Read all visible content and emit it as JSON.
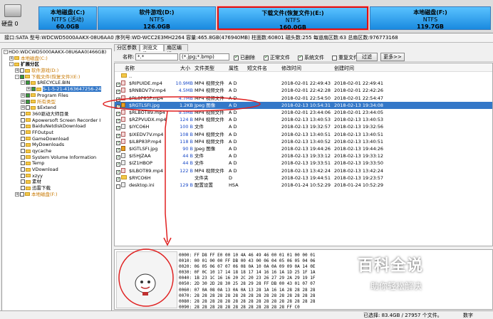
{
  "disk": {
    "label": "硬盘 0"
  },
  "partitions": [
    {
      "name": "本地磁盘(C:)",
      "fs": "NTFS (活动)",
      "size": "60.0GB"
    },
    {
      "name": "软件游戏(D:)",
      "fs": "NTFS",
      "size": "126.0GB"
    },
    {
      "name": "下载文件(恢复文件)(E:)",
      "fs": "NTFS",
      "size": "160.0GB"
    },
    {
      "name": "本地磁盘(F:)",
      "fs": "NTFS",
      "size": "119.7GB"
    }
  ],
  "diskinfo": "接口:SATA  型号:WDCWD5000AAKX-08U6AA0  序列号:WD-WCC2E3MH2264  容量:465.8GB(476940MB)  柱面数:60801  磁头数:255  每道扇区数:63  总扇区数:976773168",
  "tree": [
    {
      "label": "HD0:WDCWD5000AAKX-08U6AA0(466GB)",
      "level": 0,
      "exp": "-",
      "cb": false,
      "folder": false,
      "style": ""
    },
    {
      "label": "本地磁盘(C:)",
      "level": 1,
      "exp": "+",
      "cb": false,
      "folder": true,
      "style": "orange"
    },
    {
      "label": "扩展分区",
      "level": 1,
      "exp": "-",
      "cb": false,
      "folder": true,
      "style": "bold"
    },
    {
      "label": "软件游戏(D:)",
      "level": 2,
      "exp": "+",
      "cb": false,
      "folder": true,
      "style": "orange"
    },
    {
      "label": "下载文件(恢复文件)(E:)",
      "level": 2,
      "exp": "-",
      "cb": true,
      "folder": true,
      "style": "orange"
    },
    {
      "label": "$RECYCLE.BIN",
      "level": 3,
      "exp": "-",
      "cb": true,
      "folder": true,
      "style": ""
    },
    {
      "label": "S-1-5-21-4163647256-24",
      "level": 4,
      "exp": "+",
      "cb": true,
      "folder": true,
      "style": "sel"
    },
    {
      "label": "Program Files",
      "level": 3,
      "exp": "+",
      "cb": true,
      "folder": true,
      "style": ""
    },
    {
      "label": "所有类型",
      "level": 3,
      "exp": "+",
      "cb": true,
      "folder": true,
      "style": "orange"
    },
    {
      "label": "$Extend",
      "level": 3,
      "exp": "+",
      "cb": false,
      "folder": true,
      "style": ""
    },
    {
      "label": "360驱动大师目录",
      "level": 3,
      "exp": "",
      "cb": false,
      "folder": true,
      "style": ""
    },
    {
      "label": "Apowersoft Screen Recorder I",
      "level": 3,
      "exp": "",
      "cb": false,
      "folder": true,
      "style": ""
    },
    {
      "label": "BaiduNetdiskDownload",
      "level": 3,
      "exp": "",
      "cb": false,
      "folder": true,
      "style": ""
    },
    {
      "label": "FFOutput",
      "level": 3,
      "exp": "",
      "cb": false,
      "folder": true,
      "style": ""
    },
    {
      "label": "GameDownload",
      "level": 3,
      "exp": "",
      "cb": false,
      "folder": true,
      "style": ""
    },
    {
      "label": "MyDownloads",
      "level": 3,
      "exp": "",
      "cb": false,
      "folder": true,
      "style": ""
    },
    {
      "label": "qycache",
      "level": 3,
      "exp": "",
      "cb": false,
      "folder": true,
      "style": ""
    },
    {
      "label": "System Volume Information",
      "level": 3,
      "exp": "",
      "cb": false,
      "folder": true,
      "style": ""
    },
    {
      "label": "Temp",
      "level": 3,
      "exp": "",
      "cb": false,
      "folder": true,
      "style": ""
    },
    {
      "label": "VDownload",
      "level": 3,
      "exp": "",
      "cb": false,
      "folder": true,
      "style": ""
    },
    {
      "label": "xzyy",
      "level": 3,
      "exp": "",
      "cb": false,
      "folder": true,
      "style": ""
    },
    {
      "label": "素材",
      "level": 3,
      "exp": "",
      "cb": false,
      "folder": true,
      "style": ""
    },
    {
      "label": "迅雷下载",
      "level": 3,
      "exp": "",
      "cb": false,
      "folder": true,
      "style": ""
    },
    {
      "label": "本地磁盘(F:)",
      "level": 2,
      "exp": "+",
      "cb": false,
      "folder": true,
      "style": "orange"
    }
  ],
  "tabs": [
    "分区参数",
    "浏览文件",
    "扇区编辑"
  ],
  "filter": {
    "label": "名称:",
    "name": "*.*",
    "types": "(*.jpg;*.bmp)",
    "opt_deleted": "已删除",
    "opt_normal": "正常文件",
    "opt_system": "系统文件",
    "opt_dup": "重复文件",
    "btn_filter": "过滤",
    "btn_more": "更多>>"
  },
  "columns": [
    "名称",
    "大小",
    "文件类型",
    "属性",
    "短文件名",
    "修改时间",
    "创建时间"
  ],
  "files": [
    {
      "name": "..",
      "size": "",
      "type": "",
      "attr": "",
      "short": "",
      "mtime": "",
      "ctime": "",
      "icon": "dir",
      "cb": null
    },
    {
      "name": "$RIPUIDE.mp4",
      "size": "10.9MB",
      "type": "MP4 视频文件",
      "attr": "A D",
      "short": "",
      "mtime": "2018-02-01 22:49:43",
      "ctime": "2018-02-01 22:49:41",
      "icon": "vid",
      "cb": true
    },
    {
      "name": "$RNBDV7V.mp4",
      "size": "4.5MB",
      "type": "MP4 视频文件",
      "attr": "A D",
      "short": "",
      "mtime": "2018-02-01 22:42:28",
      "ctime": "2018-02-01 22:42:26",
      "icon": "vid",
      "cb": true
    },
    {
      "name": "$RL8P83P.mp4",
      "size": "4.7MB",
      "type": "MP4 视频文件",
      "attr": "A D",
      "short": "",
      "mtime": "2018-02-01 22:54:50",
      "ctime": "2018-02-01 22:54:47",
      "icon": "vid",
      "cb": true
    },
    {
      "name": "$RGTLSFI.jpg",
      "size": "1.2KB",
      "type": "Jpeg 图像",
      "attr": "A D",
      "short": "",
      "mtime": "2018-02-13 10:54:31",
      "ctime": "2018-02-13 19:34:08",
      "icon": "img",
      "cb": true,
      "sel": true
    },
    {
      "name": "$RLBOT89.mp4",
      "size": "9.5MB",
      "type": "MP4 视频文件",
      "attr": "A D",
      "short": "",
      "mtime": "2018-02-01 23:44:06",
      "ctime": "2018-02-01 23:44:05",
      "icon": "vid",
      "cb": true
    },
    {
      "name": "$RZPVUDX.mp4",
      "size": "124 B",
      "type": "MP4 视频文件",
      "attr": "A D",
      "short": "",
      "mtime": "2018-02-13 13:40:53",
      "ctime": "2018-02-13 13:40:53",
      "icon": "vid",
      "cb": true
    },
    {
      "name": "$IYCO6H",
      "size": "100 B",
      "type": "文件",
      "attr": "A D",
      "short": "",
      "mtime": "2018-02-13 19:32:57",
      "ctime": "2018-02-13 19:32:56",
      "icon": "ini",
      "cb": true
    },
    {
      "name": "$IXEDV7V.mp4",
      "size": "108 B",
      "type": "MP4 视频文件",
      "attr": "A D",
      "short": "",
      "mtime": "2018-02-13 13:40:51",
      "ctime": "2018-02-13 13:40:51",
      "icon": "vid",
      "cb": true
    },
    {
      "name": "$IL8P83P.mp4",
      "size": "118 B",
      "type": "MP4 视频文件",
      "attr": "A D",
      "short": "",
      "mtime": "2018-02-13 13:40:52",
      "ctime": "2018-02-13 13:40:51",
      "icon": "vid",
      "cb": true
    },
    {
      "name": "$IGTLSFI.jpg",
      "size": "90 B",
      "type": "Jpeg 图像",
      "attr": "A D",
      "short": "",
      "mtime": "2018-02-13 19:44:26",
      "ctime": "2018-02-13 19:44:26",
      "icon": "img",
      "cb": true
    },
    {
      "name": "$I5HJZAA",
      "size": "44 B",
      "type": "文件",
      "attr": "A D",
      "short": "",
      "mtime": "2018-02-13 19:33:12",
      "ctime": "2018-02-13 19:33:12",
      "icon": "ini",
      "cb": true
    },
    {
      "name": "$IZ1HBOP",
      "size": "44 B",
      "type": "文件",
      "attr": "A D",
      "short": "",
      "mtime": "2018-02-13 19:33:51",
      "ctime": "2018-02-13 19:33:50",
      "icon": "ini",
      "cb": true
    },
    {
      "name": "$ILBOT89.mp4",
      "size": "122 B",
      "type": "MP4 视频文件",
      "attr": "A D",
      "short": "",
      "mtime": "2018-02-13 13:42:24",
      "ctime": "2018-02-13 13:42:24",
      "icon": "vid",
      "cb": true
    },
    {
      "name": "$RYCO6H",
      "size": "",
      "type": "文件夹",
      "attr": "D",
      "short": "",
      "mtime": "2018-02-13 19:44:51",
      "ctime": "2018-02-13 19:23:57",
      "icon": "dir",
      "cb": true
    },
    {
      "name": "desktop.ini",
      "size": "129 B",
      "type": "配置设置",
      "attr": "HSA",
      "short": "",
      "mtime": "2018-01-24 10:52:29",
      "ctime": "2018-01-24 10:52:29",
      "icon": "ini",
      "cb": false
    }
  ],
  "hex": [
    "0000: FF D8 FF E0 00 10 4A 46 49 46 00 01 01 00 00 01",
    "0010: 00 01 00 00 FF DB 00 43 00 06 04 05 06 05 04 06",
    "0020: 06 05 06 07 07 06 08 0A 10 0A 0A 09 09 0A 14 0E",
    "0030: 0F 0C 10 17 14 18 18 17 14 16 16 1A 1D 25 1F 1A",
    "0040: 1B 23 1C 16 16 20 2C 20 23 26 27 29 2A 29 19 1F",
    "0050: 2D 30 2D 28 30 25 28 29 28 FF DB 00 43 01 07 07",
    "0060: 07 0A 08 0A 13 0A 0A 13 28 1A 16 1A 28 28 28 28",
    "0070: 28 28 28 28 28 28 28 28 28 28 28 28 28 28 28 28",
    "0080: 28 28 28 28 28 28 28 28 28 28 28 28 28 28 28 28",
    "0090: 28 28 28 28 28 28 28 28 28 28 28 28 FF C0"
  ],
  "status": {
    "selected": "已选择: 83.4GB / 27957 个文件。",
    "mode": "数字"
  },
  "watermark": {
    "big": "百科全说",
    "small": "助你轻松解决"
  }
}
